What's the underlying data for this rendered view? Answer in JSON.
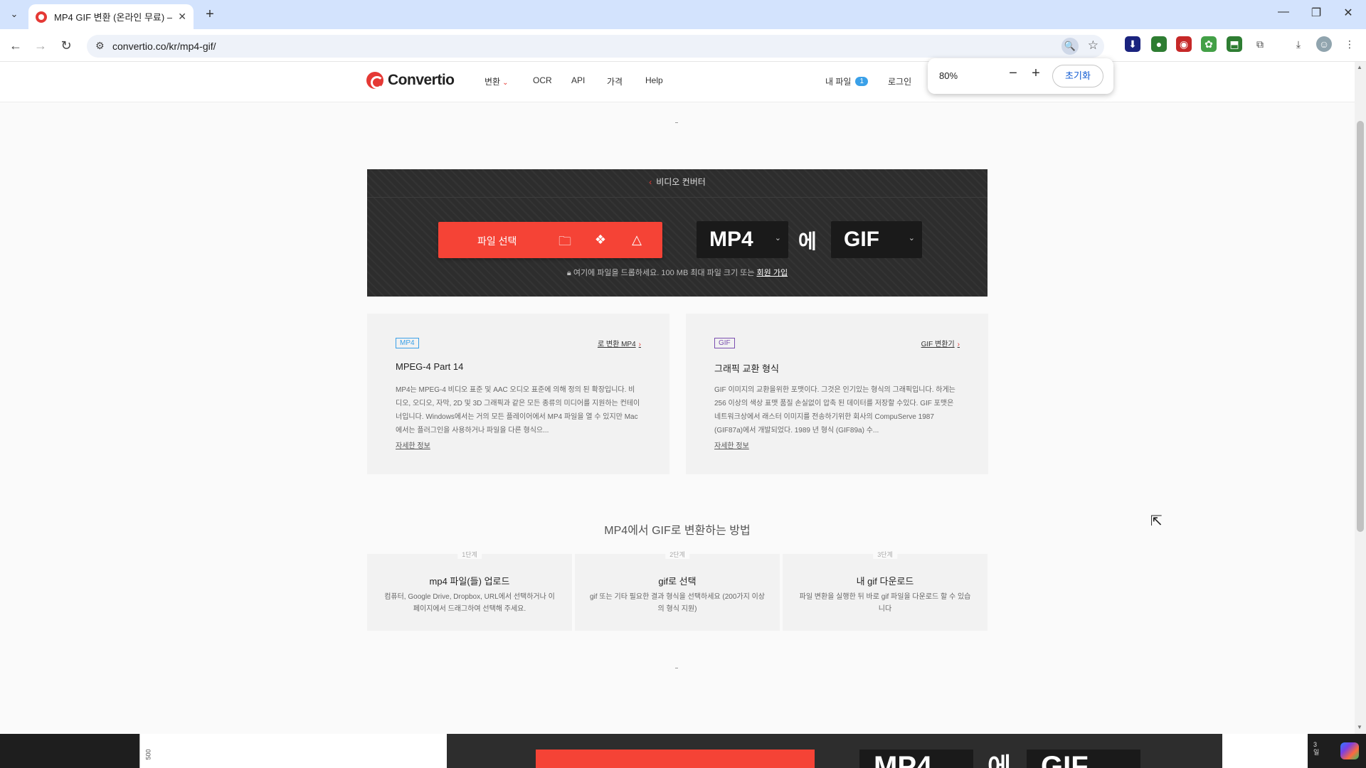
{
  "browser": {
    "tab_title": "MP4 GIF 변환 (온라인 무료) —",
    "url": "convertio.co/kr/mp4-gif/",
    "new_tab": "+",
    "zoom_popup": {
      "percent": "80%",
      "minus": "−",
      "plus": "+",
      "reset_label": "초기화"
    }
  },
  "header": {
    "logo_text": "Convertio",
    "nav": [
      {
        "label": "변환"
      },
      {
        "label": "OCR"
      },
      {
        "label": "API"
      },
      {
        "label": "가격"
      },
      {
        "label": "Help"
      }
    ],
    "my_files": "내 파일",
    "my_files_count": "1",
    "login": "로그인"
  },
  "converter": {
    "breadcrumb": "비디오 컨버터",
    "choose_file": "파일 선택",
    "from_format": "MP4",
    "to_word": "에",
    "to_format": "GIF",
    "drop_hint": "여기에 파일을 드롭하세요. 100 MB 최대 파일 크기 또는",
    "signup": "회원 가입"
  },
  "cards": [
    {
      "tag": "MP4",
      "link": "로 변환 MP4",
      "name": "MPEG-4 Part 14",
      "desc": "MP4는 MPEG-4 비디오 표준 및 AAC 오디오 표준에 의해 정의 된 확장입니다. 비디오, 오디오, 자막, 2D 및 3D 그래픽과 같은 모든 종류의 미디어를 지원하는 컨테이너입니다. Windows에서는 거의 모든 플레이어에서 MP4 파일을 열 수 있지만 Mac에서는 플러그인을 사용하거나 파일을 다른 형식으...",
      "more": "자세한 정보"
    },
    {
      "tag": "GIF",
      "link": "GIF 변환기",
      "name": "그래픽 교환 형식",
      "desc": "GIF 이미지의 교환을위한 포맷이다. 그것은 인기있는 형식의 그래픽입니다. 하게는 256 이상의 색상 표맷 품질 손실없이 압축 된 데이터를 저장할 수있다. GIF 포맷은 네트워크상에서 래스터 이미지를 전송하기위한 회사의 CompuServe 1987 (GIF87a)에서 개발되었다. 1989 년 형식 (GIF89a) 수...",
      "more": "자세한 정보"
    }
  ],
  "howto": {
    "title": "MP4에서 GIF로 변환하는 방법",
    "steps": [
      {
        "num": "1단계",
        "title": "mp4 파일(들) 업로드",
        "desc": "컴퓨터, Google Drive, Dropbox, URL에서 선택하거나 이 페이지에서 드래그하여 선택해 주세요."
      },
      {
        "num": "2단계",
        "title": "gif로 선택",
        "desc": "gif 또는 기타 필요한 결과 형식을 선택하세요 (200가지 이상의 형식 지원)"
      },
      {
        "num": "3단계",
        "title": "내 gif 다운로드",
        "desc": "파일 변환을 실행한 뒤 바로 gif 파일을 다운로드 할 수 있습니다"
      }
    ]
  },
  "bottom": {
    "ruler_label": "500",
    "preview_from": "MP4",
    "preview_word": "에",
    "preview_to": "GIF",
    "clock": "3\n일"
  },
  "colors": {
    "accent": "#f54336",
    "dark": "#2d2d2d",
    "mp4_tag": "#3aa0e8",
    "gif_tag": "#7b4fb0"
  }
}
